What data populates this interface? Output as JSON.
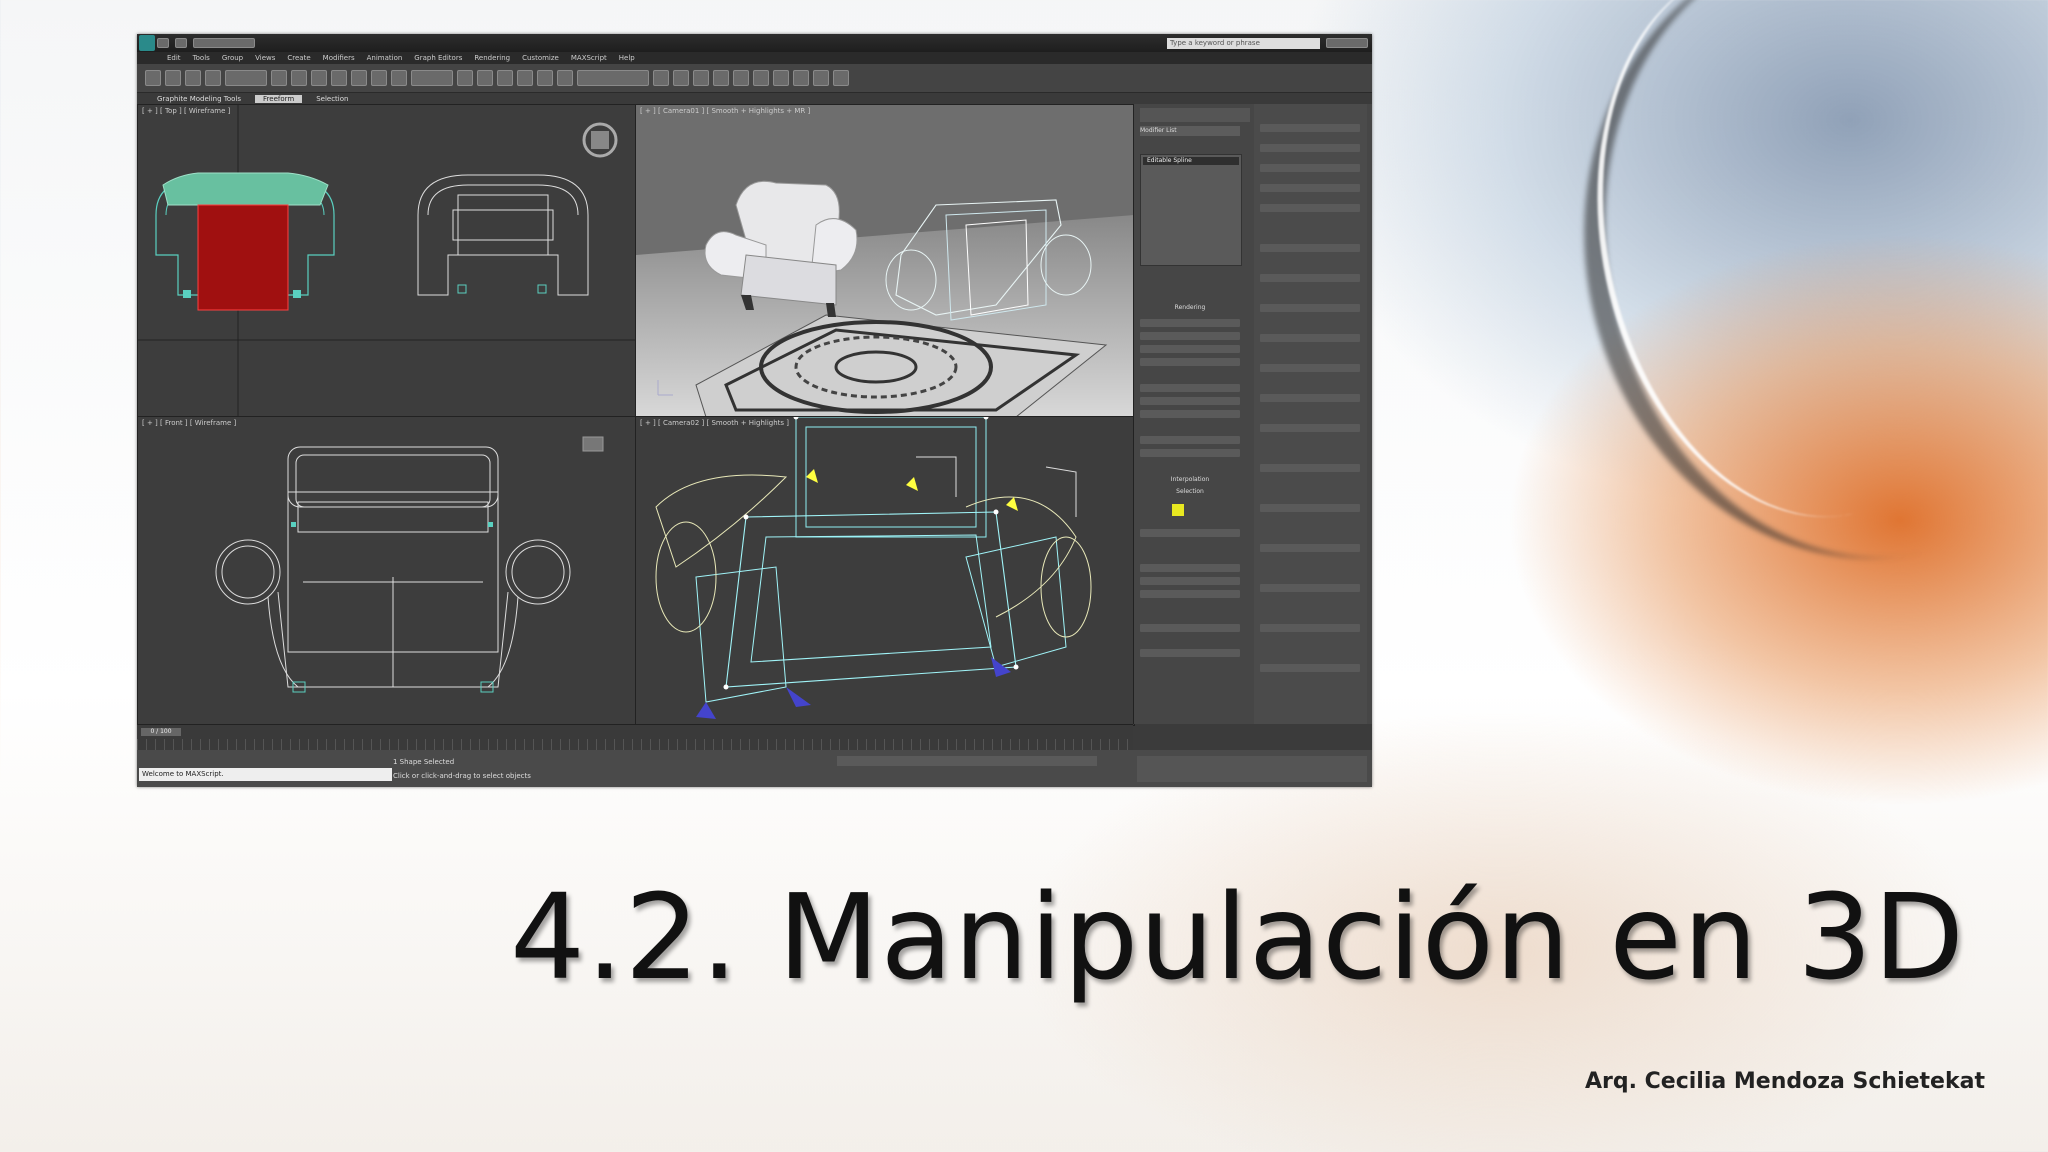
{
  "slide": {
    "title": "4.2. Manipulación en 3D",
    "author": "Arq. Cecilia Mendoza Schietekat"
  },
  "app": {
    "search_placeholder": "Type a keyword or phrase",
    "menu": [
      "Edit",
      "Tools",
      "Group",
      "Views",
      "Create",
      "Modifiers",
      "Animation",
      "Graph Editors",
      "Rendering",
      "Customize",
      "MAXScript",
      "Help"
    ],
    "ribbon": {
      "tool_name": "Graphite Modeling Tools",
      "active_tab": "Freeform",
      "tab2": "Selection"
    },
    "viewports": {
      "top": "[ + ] [ Top ] [ Wireframe ]",
      "perspective": "[ + ] [ Camera01 ] [ Smooth + Highlights + MR ]",
      "front": "[ + ] [ Front ] [ Wireframe ]",
      "camera2": "[ + ] [ Camera02 ] [ Smooth + Highlights ]"
    },
    "command_panel": {
      "modifier_list": "Modifier List",
      "stack_item": "Editable Spline",
      "rollout_rendering": "Rendering",
      "rollout_interpolation": "Interpolation",
      "rollout_selection": "Selection"
    },
    "timeline": {
      "frame": "0 / 100"
    },
    "status": {
      "maxscript": "Welcome to MAXScript.",
      "selected": "1 Shape Selected",
      "hint": "Click or click-and-drag to select objects"
    }
  }
}
